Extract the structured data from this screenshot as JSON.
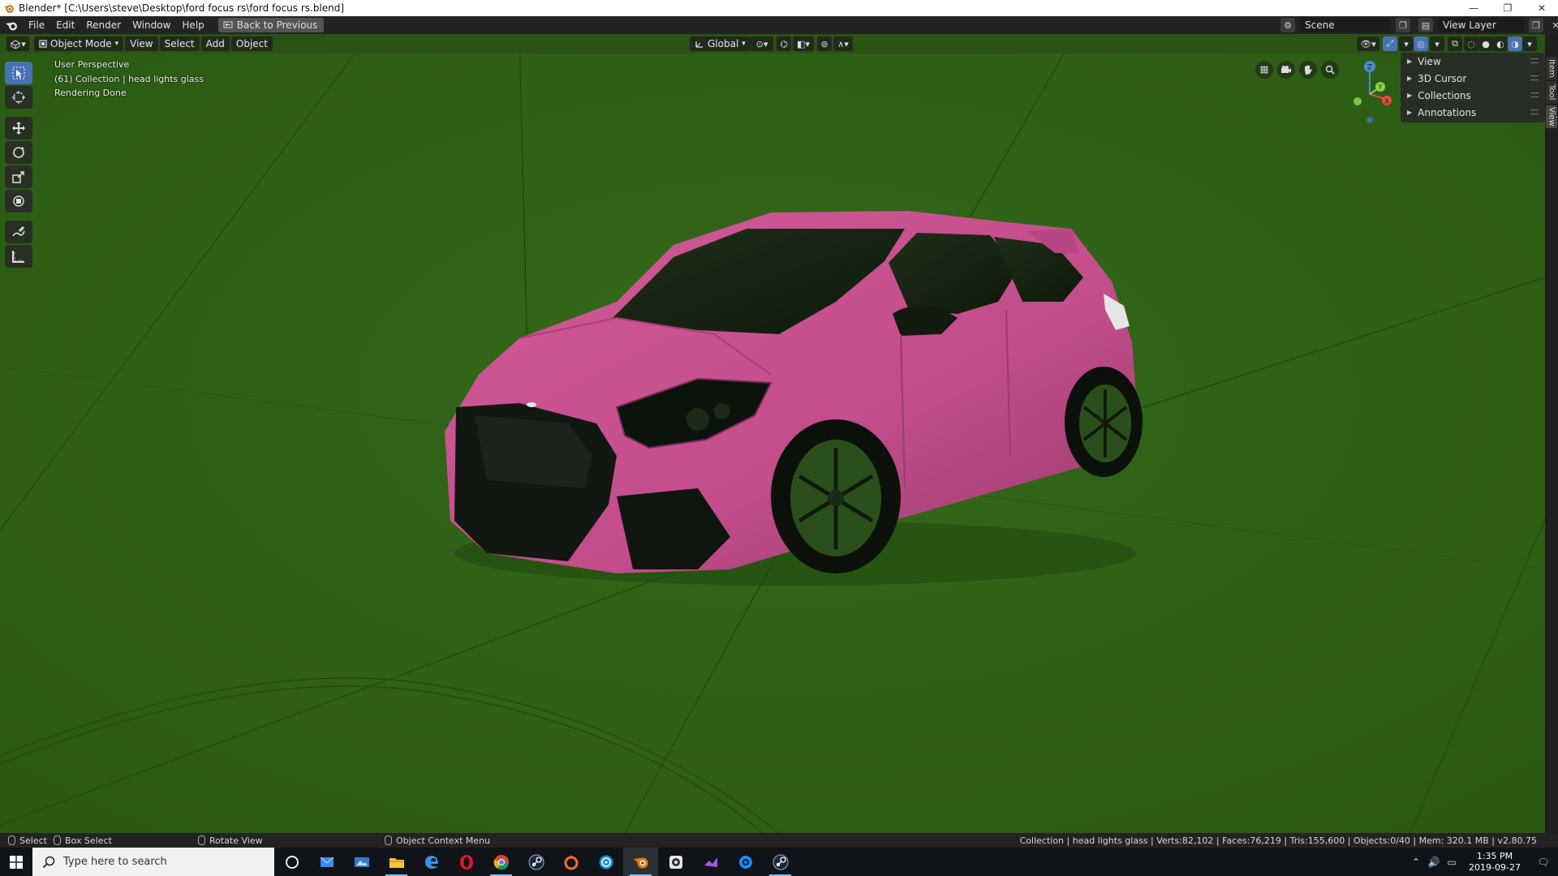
{
  "window": {
    "title": "Blender* [C:\\Users\\steve\\Desktop\\ford focus rs\\ford focus rs.blend]",
    "minimize": "—",
    "restore": "❐",
    "close": "✕"
  },
  "menu": {
    "items": [
      "File",
      "Edit",
      "Render",
      "Window",
      "Help"
    ],
    "back_button": "Back to Previous",
    "scene_label": "Scene",
    "view_layer_label": "View Layer"
  },
  "viewport_header": {
    "mode": "Object Mode",
    "menus": [
      "View",
      "Select",
      "Add",
      "Object"
    ],
    "transform_orientation": "Global"
  },
  "viewport": {
    "info_lines": [
      "User Perspective",
      "(61) Collection | head lights glass",
      "Rendering Done"
    ],
    "background_color": "#2f6315",
    "car_color": "#c24d8a"
  },
  "npanel": {
    "items": [
      "View",
      "3D Cursor",
      "Collections",
      "Annotations"
    ],
    "tabs": [
      "Item",
      "Tool",
      "View"
    ]
  },
  "gizmo": {
    "z": "Z",
    "x": "X",
    "y": "Y"
  },
  "statusbar": {
    "select": "Select",
    "box_select": "Box Select",
    "rotate_view": "Rotate View",
    "context_menu": "Object Context Menu",
    "stats": "Collection | head lights glass | Verts:82,102 | Faces:76,219 | Tris:155,600 | Objects:0/40 | Mem: 320.1 MB | v2.80.75"
  },
  "taskbar": {
    "search_placeholder": "Type here to search",
    "time": "1:35 PM",
    "date": "2019-09-27",
    "apps": [
      "cortana-icon",
      "mail-icon",
      "photos-icon",
      "file-explorer-icon",
      "edge-icon",
      "opera-icon",
      "chrome-icon",
      "steam-icon",
      "origin-icon",
      "uplay-icon",
      "blender-icon",
      "obs-icon",
      "visual-studio-icon",
      "battlenet-icon",
      "steam-icon"
    ]
  }
}
